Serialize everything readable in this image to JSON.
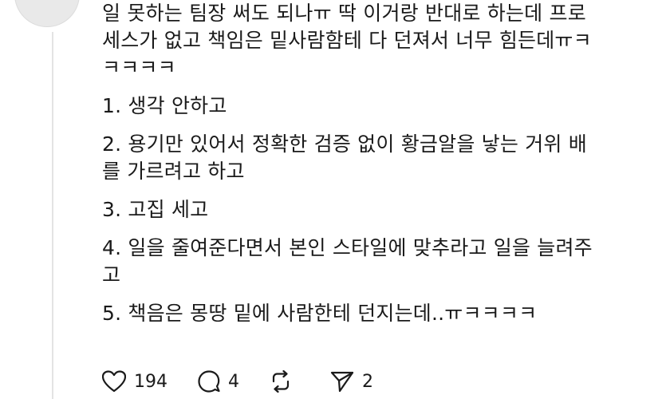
{
  "post": {
    "paragraph1": [
      "일 못하는 팀장 써도 되나ㅠ 딱 이거랑 반대로 하는데 프로",
      "세스가 없고 책임은 밑사람함테 다 던져서 너무 힘든데ㅠㅋ",
      "ㅋㅋㅋㅋ"
    ],
    "items": [
      [
        "1. 생각 안하고"
      ],
      [
        "2. 용기만 있어서 정확한 검증 없이 황금알을 낳는 거위 배",
        "를 가르려고 하고"
      ],
      [
        "3. 고집 세고"
      ],
      [
        "4. 일을 줄여준다면서 본인 스타일에 맞추라고 일을 늘려주",
        "고"
      ],
      [
        "5. 책음은 몽땅 밑에 사람한테 던지는데..ㅠㅋㅋㅋㅋ"
      ]
    ]
  },
  "actions": {
    "likes": "194",
    "comments": "4",
    "reposts": "",
    "shares": "2"
  },
  "icons": [
    "plus-icon",
    "heart-icon",
    "comment-icon",
    "repost-icon",
    "send-icon"
  ]
}
